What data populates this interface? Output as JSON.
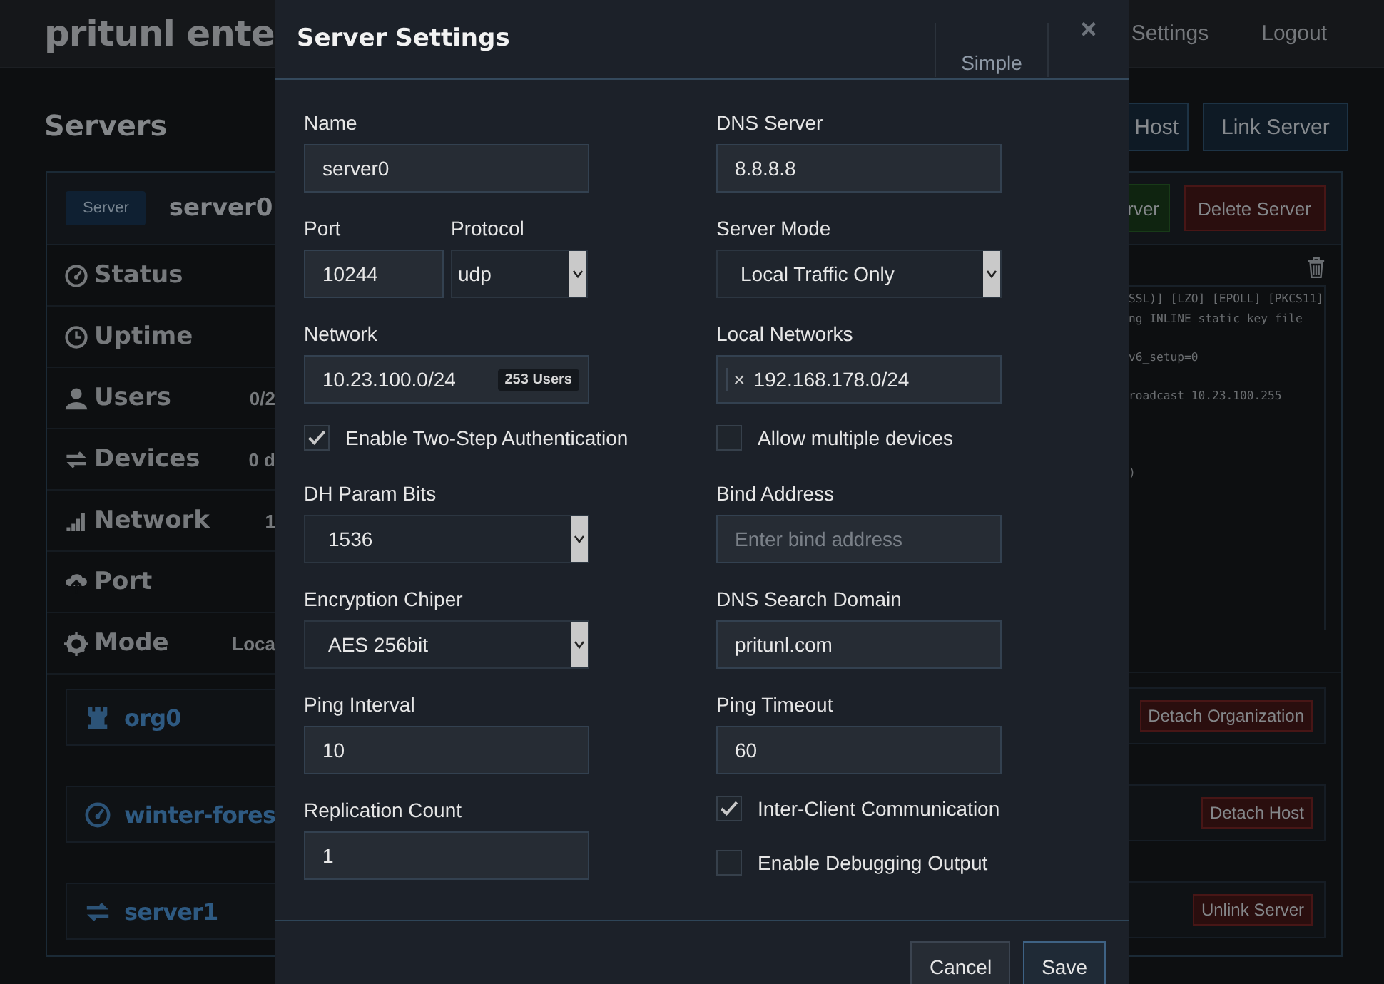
{
  "navbar": {
    "brand": "pritunl ente",
    "links": [
      "Settings",
      "Logout"
    ]
  },
  "page": {
    "title": "Servers",
    "buttons": [
      "Host",
      "Link Server"
    ]
  },
  "server_panel": {
    "badge": "Server",
    "name": "server0",
    "buttons": [
      {
        "label": "rver",
        "kind": "start"
      },
      {
        "label": "Delete Server",
        "kind": "delete"
      }
    ],
    "stats": [
      {
        "label": "Status"
      },
      {
        "label": "Uptime"
      },
      {
        "label": "Users",
        "value": "0/2"
      },
      {
        "label": "Devices",
        "value": "0 d"
      },
      {
        "label": "Network",
        "value": "1"
      },
      {
        "label": "Port"
      },
      {
        "label": "Mode",
        "value": "Loca"
      }
    ],
    "log_lines": [
      "SSL)] [LZO] [EPOLL] [PKCS11]",
      "ng INLINE static key file",
      "v6_setup=0",
      "roadcast 10.23.100.255",
      ")"
    ],
    "links": [
      {
        "name": "org0",
        "action": "Detach Organization"
      },
      {
        "name": "winter-fores",
        "action": "Detach Host"
      },
      {
        "name": "server1",
        "action": "Unlink Server"
      }
    ]
  },
  "modal": {
    "title": "Server Settings",
    "mode_button": "Simple",
    "close": "×",
    "columns": [
      [
        {
          "kind": "text",
          "label": "Name",
          "value": "server0"
        },
        {
          "kind": "pair",
          "fields": [
            {
              "kind": "text",
              "label": "Port",
              "value": "10244"
            },
            {
              "kind": "select",
              "label": "Protocol",
              "value": "udp"
            }
          ]
        },
        {
          "kind": "badge",
          "label": "Network",
          "value": "10.23.100.0/24",
          "badge": "253 Users"
        },
        {
          "kind": "checkbox",
          "label": "Enable Two-Step Authentication",
          "checked": true
        },
        {
          "kind": "select",
          "label": "DH Param Bits",
          "value": "1536"
        },
        {
          "kind": "select",
          "label": "Encryption Chiper",
          "value": "AES 256bit"
        },
        {
          "kind": "text",
          "label": "Ping Interval",
          "value": "10"
        },
        {
          "kind": "text",
          "label": "Replication Count",
          "value": "1"
        }
      ],
      [
        {
          "kind": "text",
          "label": "DNS Server",
          "value": "8.8.8.8"
        },
        {
          "kind": "select",
          "label": "Server Mode",
          "value": "Local Traffic Only"
        },
        {
          "kind": "tags",
          "label": "Local Networks",
          "tags": [
            {
              "remove": "×",
              "value": "192.168.178.0/24"
            }
          ]
        },
        {
          "kind": "checkbox",
          "label": "Allow multiple devices",
          "checked": false
        },
        {
          "kind": "text",
          "label": "Bind Address",
          "placeholder": "Enter bind address"
        },
        {
          "kind": "text",
          "label": "DNS Search Domain",
          "value": "pritunl.com"
        },
        {
          "kind": "text",
          "label": "Ping Timeout",
          "value": "60"
        },
        {
          "kind": "checkbox",
          "label": "Inter-Client Communication",
          "checked": true
        },
        {
          "kind": "checkbox",
          "label": "Enable Debugging Output",
          "checked": false
        }
      ]
    ],
    "footer_buttons": [
      {
        "label": "Cancel",
        "kind": "default"
      },
      {
        "label": "Save",
        "kind": "primary"
      }
    ]
  }
}
